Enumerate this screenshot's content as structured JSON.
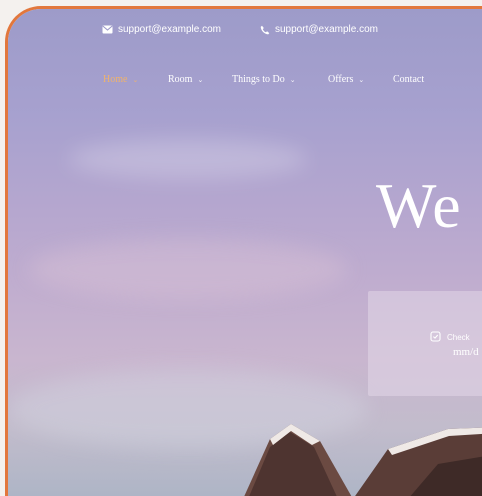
{
  "topbar": {
    "email": "support@example.com",
    "phone": "support@example.com"
  },
  "nav": {
    "items": [
      {
        "label": "Home",
        "active": true,
        "dropdown": true
      },
      {
        "label": "Room",
        "active": false,
        "dropdown": true
      },
      {
        "label": "Things to Do",
        "active": false,
        "dropdown": true
      },
      {
        "label": "Offers",
        "active": false,
        "dropdown": true
      },
      {
        "label": "Contact",
        "active": false,
        "dropdown": false
      }
    ]
  },
  "hero": {
    "title_partial": "We"
  },
  "booking": {
    "check_label": "Check",
    "date_placeholder": "mm/d"
  },
  "colors": {
    "accent": "#e2773c",
    "nav_active": "#f0b36b"
  }
}
